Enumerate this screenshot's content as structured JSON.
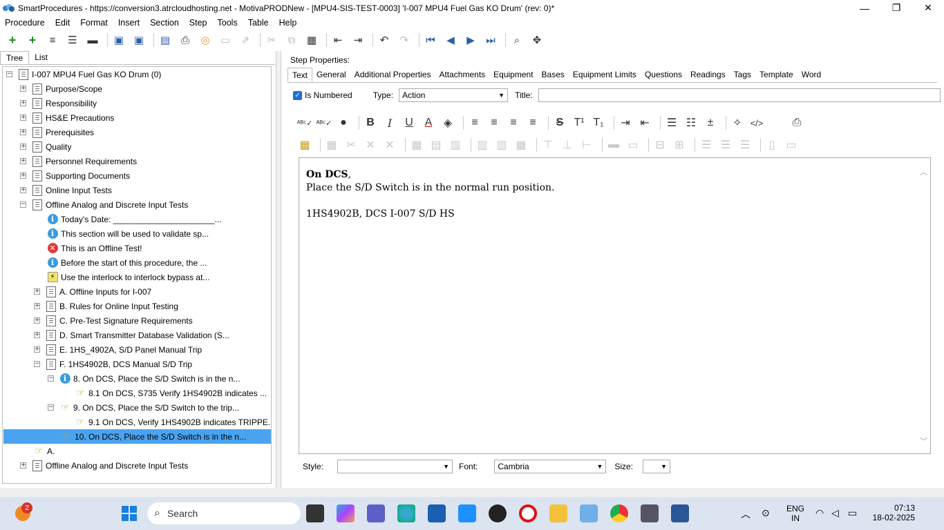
{
  "window": {
    "title": "SmartProcedures - https://conversion3.atrcloudhosting.net - MotivaPRODNew - [MPU4-SIS-TEST-0003] 'I-007 MPU4 Fuel Gas KO Drum' (rev: 0)*",
    "minimize": "—",
    "restore": "❐",
    "close": "✕"
  },
  "menu": [
    "Procedure",
    "Edit",
    "Format",
    "Insert",
    "Section",
    "Step",
    "Tools",
    "Table",
    "Help"
  ],
  "left_tabs": [
    "Tree",
    "List"
  ],
  "tree": {
    "root": "I-007 MPU4 Fuel Gas KO Drum (0)",
    "sections": [
      "Purpose/Scope",
      "Responsibility",
      "HS&E Precautions",
      "Prerequisites",
      "Quality",
      "Personnel Requirements",
      "Supporting Documents",
      "Online Input Tests",
      "Offline Analog and Discrete Input Tests"
    ],
    "offline_children": {
      "todays_date": "Today's Date: ______________________...",
      "validate": "This section will be used to validate sp...",
      "offline_test": "This is an Offline Test!",
      "before_start": "Before the start of this procedure, the ...",
      "interlock": "Use the interlock to interlock bypass at...",
      "sub_a": "A. Offline Inputs for I-007",
      "sub_b": "B. Rules for Online Input Testing",
      "sub_c": "C. Pre-Test Signature Requirements",
      "sub_d": "D. Smart Transmitter Database Validation (S...",
      "sub_e": "E. 1HS_4902A, S/D Panel Manual Trip",
      "sub_f": "F. 1HS4902B, DCS Manual S/D Trip"
    },
    "f_children": {
      "step8": "8. On DCS, Place the S/D Switch is in the n...",
      "step81": "8.1 On DCS, S735 Verify 1HS4902B  indicates ...",
      "step9": "9. On DCS, Place the S/D Switch to the trip...",
      "step91": "9.1 On DCS, Verify 1HS4902B indicates TRIPPE...",
      "step10": "10. On DCS, Place the S/D Switch is in the n..."
    },
    "step_a": "A.",
    "last_section": "Offline Analog and Discrete Input Tests"
  },
  "step_properties": {
    "label": "Step Properties:",
    "tabs": [
      "Text",
      "General",
      "Additional Properties",
      "Attachments",
      "Equipment",
      "Bases",
      "Equipment Limits",
      "Questions",
      "Readings",
      "Tags",
      "Template",
      "Word"
    ],
    "is_numbered_label": "Is Numbered",
    "is_numbered": true,
    "type_label": "Type:",
    "type_value": "Action",
    "title_label": "Title:",
    "title_value": ""
  },
  "editor": {
    "line1_bold": "On DCS",
    "line1_rest": ",",
    "line2": "Place the S/D Switch is in the normal run position.",
    "line3": "1HS4902B, DCS I-007 S/D HS"
  },
  "bottom": {
    "style_label": "Style:",
    "style_value": "",
    "font_label": "Font:",
    "font_value": "Cambria",
    "size_label": "Size:",
    "size_value": ""
  },
  "taskbar": {
    "search_placeholder": "Search",
    "notification_badge": "2",
    "lang": "ENG",
    "region": "IN",
    "time": "07:13",
    "date": "18-02-2025"
  }
}
